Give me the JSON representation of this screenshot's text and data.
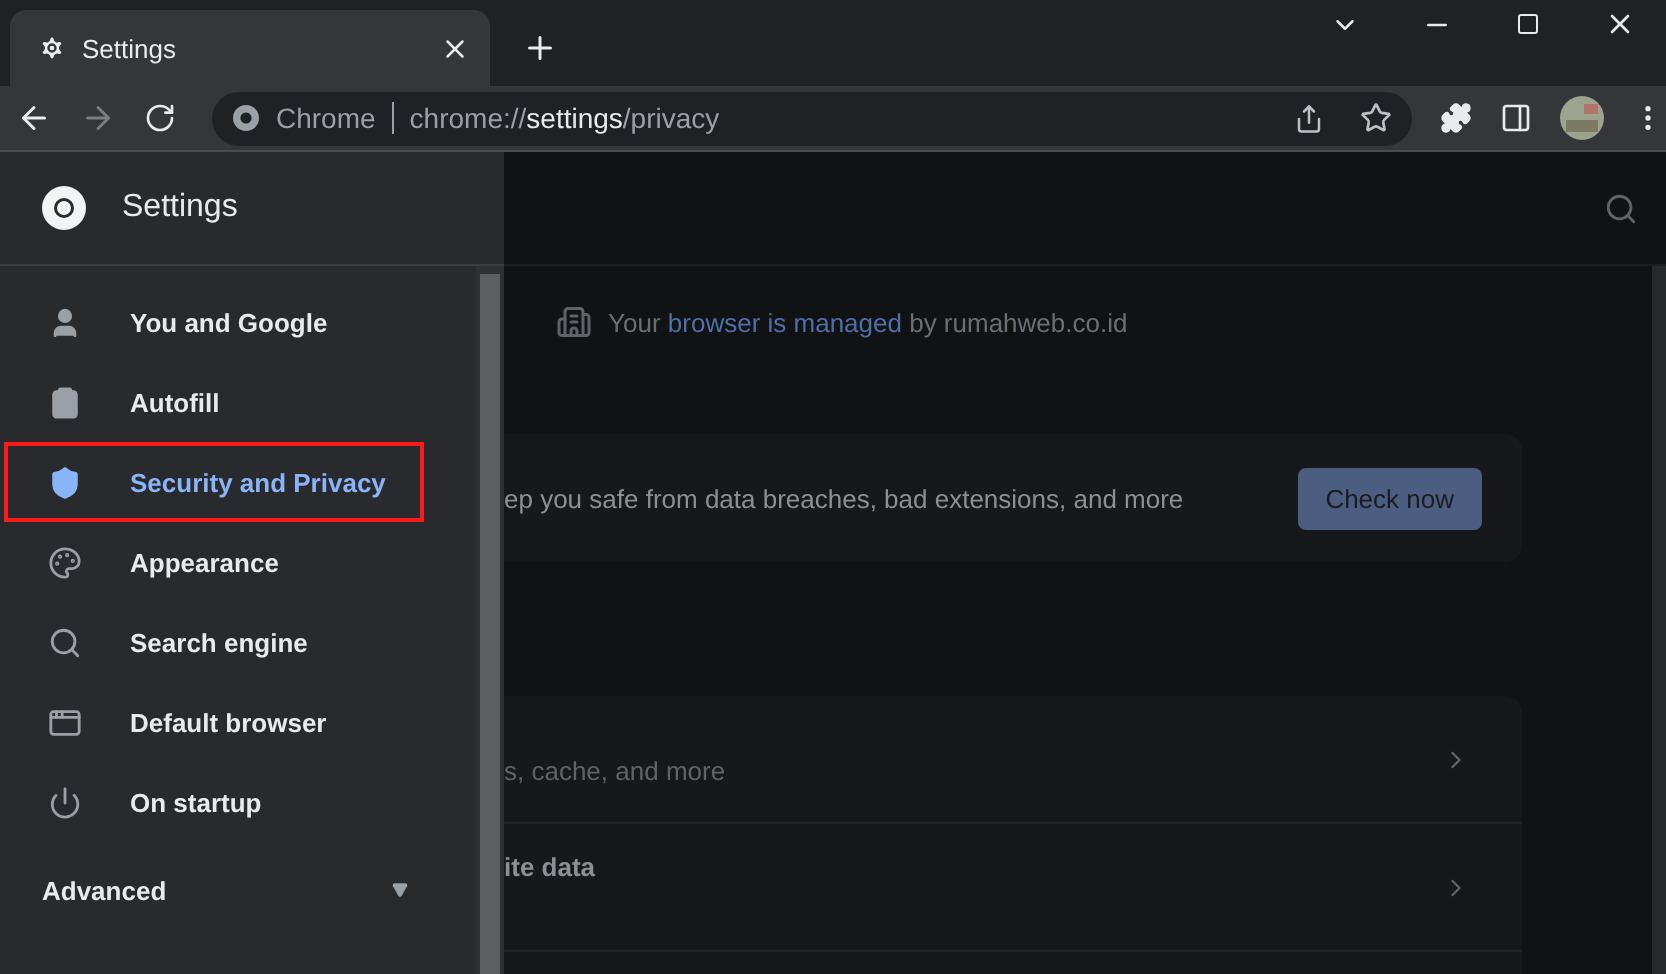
{
  "tab": {
    "title": "Settings",
    "selected": true
  },
  "address": {
    "origin": "Chrome",
    "scheme": "chrome://",
    "host": "settings",
    "path": "/privacy"
  },
  "drawer": {
    "title": "Settings",
    "items": [
      {
        "label": "You and Google",
        "selected": false
      },
      {
        "label": "Autofill",
        "selected": false
      },
      {
        "label": "Security and Privacy",
        "selected": true
      },
      {
        "label": "Appearance",
        "selected": false
      },
      {
        "label": "Search engine",
        "selected": false
      },
      {
        "label": "Default browser",
        "selected": false
      },
      {
        "label": "On startup",
        "selected": false
      }
    ],
    "advanced": {
      "label": "Advanced",
      "expanded": false
    }
  },
  "managed_notice": {
    "before": "Your",
    "link": "browser is managed",
    "after": "by rumahweb.co.id"
  },
  "safety_check": {
    "text": "ep you safe from data breaches, bad extensions, and more",
    "button": "Check now"
  },
  "privacy_rows": [
    {
      "kind": "subtitle",
      "text": "s, cache, and more"
    },
    {
      "kind": "title",
      "text": "ite data"
    }
  ]
}
